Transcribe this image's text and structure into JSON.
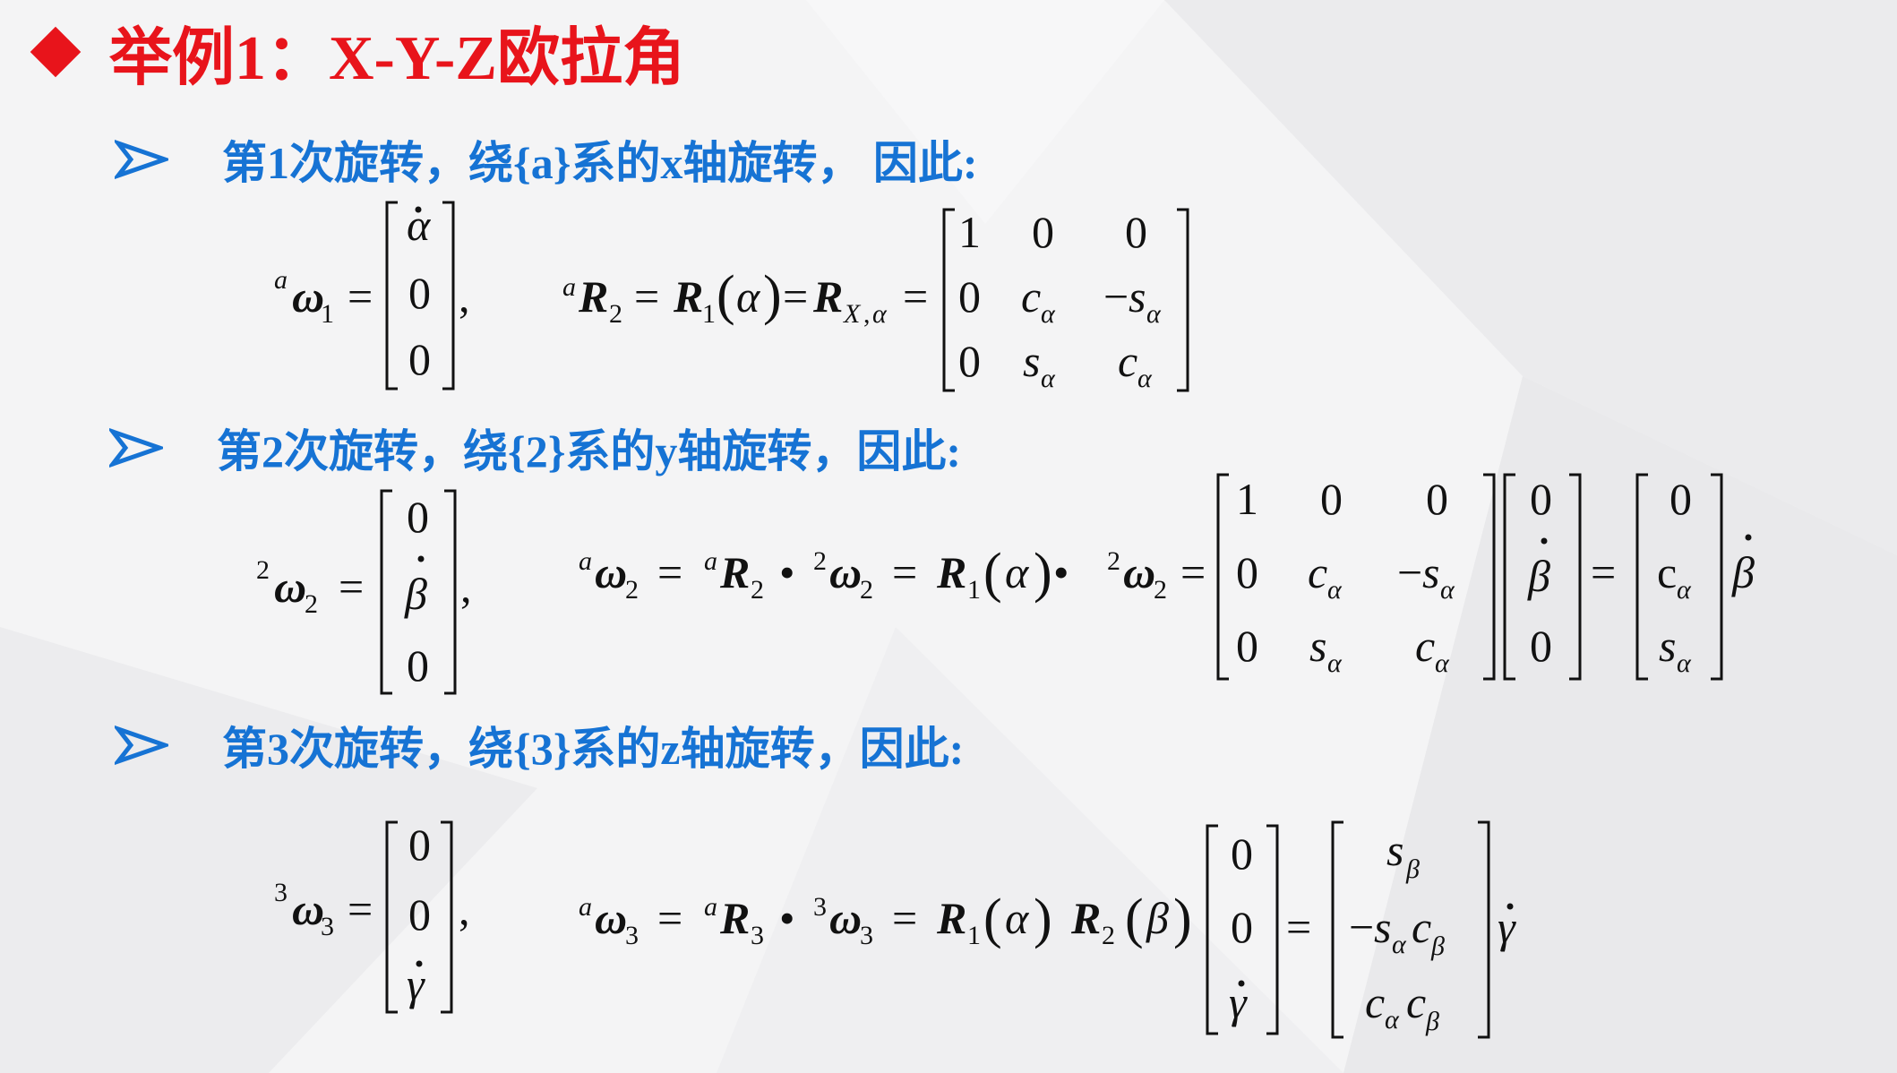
{
  "title": {
    "text": "举例1：X-Y-Z欧拉角"
  },
  "steps": [
    {
      "text": "第1次旋转，绕{a}系的x轴旋转， 因此:"
    },
    {
      "text": "第2次旋转，绕{2}系的y轴旋转，因此:"
    },
    {
      "text": "第3次旋转，绕{3}系的z轴旋转，因此:"
    }
  ],
  "math": {
    "alpha": "α",
    "beta": "β",
    "gamma": "γ",
    "omega": "ω",
    "R": "R",
    "X": "X",
    "a": "a",
    "minus": "−",
    "bullet": "•",
    "c": "c",
    "s": "s",
    "zero": "0",
    "one": "1",
    "two": "2",
    "three": "3",
    "comma": ",",
    "equals": "=",
    "lparen": "(",
    "rparen": ")"
  },
  "colors": {
    "title": "#e8141b",
    "bullet": "#1673d4",
    "background": "#f3f3f4"
  },
  "icons": {
    "title_marker": "diamond-icon",
    "step_marker": "arrow-bullet-icon"
  }
}
